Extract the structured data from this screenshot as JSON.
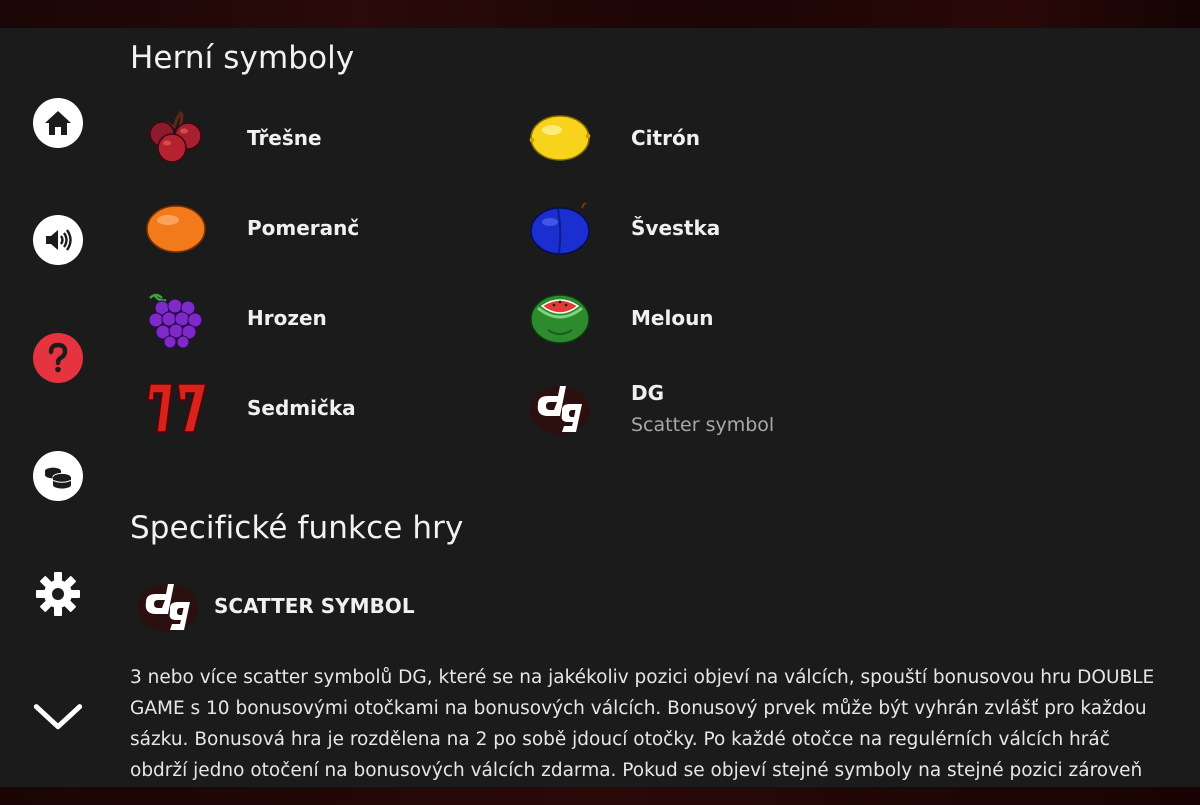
{
  "sections": {
    "game_symbols_title": "Herní symboly",
    "features_title": "Specifické funkce hry"
  },
  "symbols": [
    {
      "label": "Třešne",
      "icon": "cherry-icon"
    },
    {
      "label": "Citrón",
      "icon": "lemon-icon"
    },
    {
      "label": "Pomeranč",
      "icon": "orange-icon"
    },
    {
      "label": "Švestka",
      "icon": "plum-icon"
    },
    {
      "label": "Hrozen",
      "icon": "grapes-icon"
    },
    {
      "label": "Meloun",
      "icon": "watermelon-icon"
    },
    {
      "label": "Sedmička",
      "icon": "seven-icon"
    },
    {
      "label": "DG",
      "sublabel": "Scatter symbol",
      "icon": "dg-scatter-icon"
    }
  ],
  "feature": {
    "title": "SCATTER SYMBOL",
    "icon": "dg-scatter-icon",
    "description": "3 nebo více scatter symbolů DG, které se na jakékoliv pozici objeví na válcích, spouští bonusovou hru DOUBLE GAME s 10 bonusovými otočkami na bonusových válcích. Bonusový prvek může být vyhrán zvlášť pro každou sázku. Bonusová hra je rozdělena na 2 po sobě jdoucí otočky. Po každé otočce na regulérních válcích hráč obdrží jedno otočení na bonusových válcích zdarma. Pokud se objeví stejné symboly na stejné pozici zároveň na obou"
  },
  "sidebar": {
    "items": [
      {
        "icon": "home-icon"
      },
      {
        "icon": "sound-icon"
      },
      {
        "icon": "help-icon"
      },
      {
        "icon": "coins-icon"
      },
      {
        "icon": "gear-icon"
      },
      {
        "icon": "chevron-down-icon"
      }
    ]
  },
  "colors": {
    "background": "#1b1b1b",
    "help_accent": "#e5333f",
    "text": "#f0f0f0",
    "subtext": "#a8a8a8"
  }
}
